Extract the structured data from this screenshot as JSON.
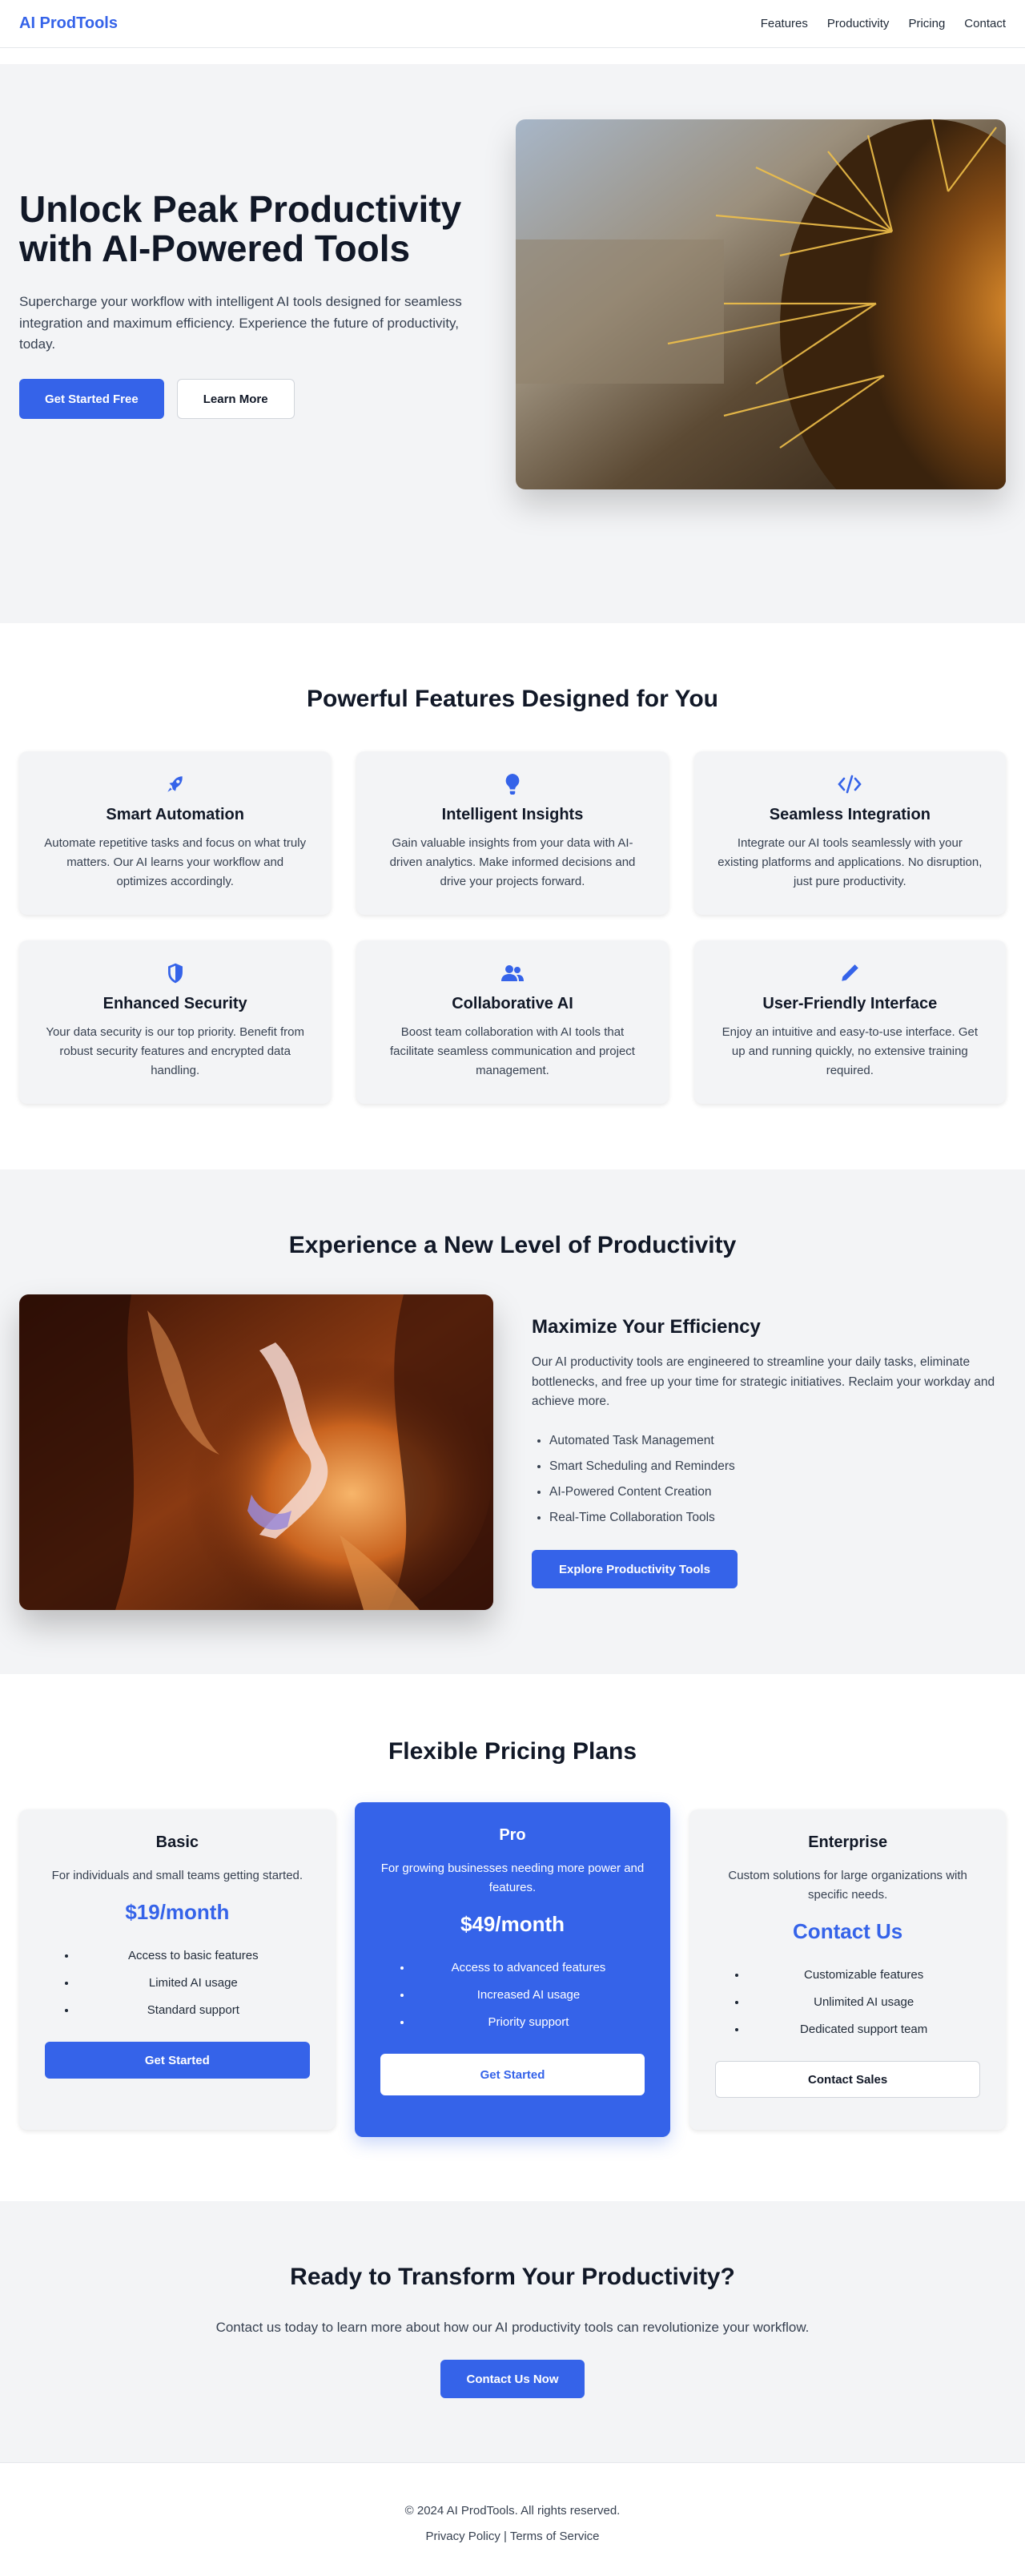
{
  "nav": {
    "brand": "AI ProdTools",
    "links": [
      "Features",
      "Productivity",
      "Pricing",
      "Contact"
    ]
  },
  "hero": {
    "title": "Unlock Peak Productivity with AI-Powered Tools",
    "subtitle": "Supercharge your workflow with intelligent AI tools designed for seamless integration and maximum efficiency. Experience the future of productivity, today.",
    "primary_cta": "Get Started Free",
    "secondary_cta": "Learn More",
    "image": "cactus-closeup-photo"
  },
  "features": {
    "title": "Powerful Features Designed for You",
    "items": [
      {
        "icon": "rocket-icon",
        "title": "Smart Automation",
        "text": "Automate repetitive tasks and focus on what truly matters. Our AI learns your workflow and optimizes accordingly."
      },
      {
        "icon": "lightbulb-icon",
        "title": "Intelligent Insights",
        "text": "Gain valuable insights from your data with AI-driven analytics. Make informed decisions and drive your projects forward."
      },
      {
        "icon": "code-icon",
        "title": "Seamless Integration",
        "text": "Integrate our AI tools seamlessly with your existing platforms and applications. No disruption, just pure productivity."
      },
      {
        "icon": "shield-icon",
        "title": "Enhanced Security",
        "text": "Your data security is our top priority. Benefit from robust security features and encrypted data handling."
      },
      {
        "icon": "users-icon",
        "title": "Collaborative AI",
        "text": "Boost team collaboration with AI tools that facilitate seamless communication and project management."
      },
      {
        "icon": "pen-icon",
        "title": "User-Friendly Interface",
        "text": "Enjoy an intuitive and easy-to-use interface. Get up and running quickly, no extensive training required."
      }
    ]
  },
  "experience": {
    "title": "Experience a New Level of Productivity",
    "heading": "Maximize Your Efficiency",
    "text": "Our AI productivity tools are engineered to streamline your daily tasks, eliminate bottlenecks, and free up your time for strategic initiatives. Reclaim your workday and achieve more.",
    "bullets": [
      "Automated Task Management",
      "Smart Scheduling and Reminders",
      "AI-Powered Content Creation",
      "Real-Time Collaboration Tools"
    ],
    "cta": "Explore Productivity Tools",
    "image": "canyon-photo"
  },
  "pricing": {
    "title": "Flexible Pricing Plans",
    "plans": [
      {
        "name": "Basic",
        "desc": "For individuals and small teams getting started.",
        "price": "$19/month",
        "features": [
          "Access to basic features",
          "Limited AI usage",
          "Standard support"
        ],
        "cta": "Get Started"
      },
      {
        "name": "Pro",
        "desc": "For growing businesses needing more power and features.",
        "price": "$49/month",
        "features": [
          "Access to advanced features",
          "Increased AI usage",
          "Priority support"
        ],
        "cta": "Get Started"
      },
      {
        "name": "Enterprise",
        "desc": "Custom solutions for large organizations with specific needs.",
        "price": "Contact Us",
        "features": [
          "Customizable features",
          "Unlimited AI usage",
          "Dedicated support team"
        ],
        "cta": "Contact Sales"
      }
    ]
  },
  "cta": {
    "title": "Ready to Transform Your Productivity?",
    "text": "Contact us today to learn more about how our AI productivity tools can revolutionize your workflow.",
    "button": "Contact Us Now"
  },
  "footer": {
    "copyright": "© 2024 AI ProdTools. All rights reserved.",
    "privacy": "Privacy Policy",
    "separator": "|",
    "terms": "Terms of Service"
  },
  "colors": {
    "accent": "#3563e9",
    "surface": "#f3f4f6",
    "text": "#1f2937"
  }
}
